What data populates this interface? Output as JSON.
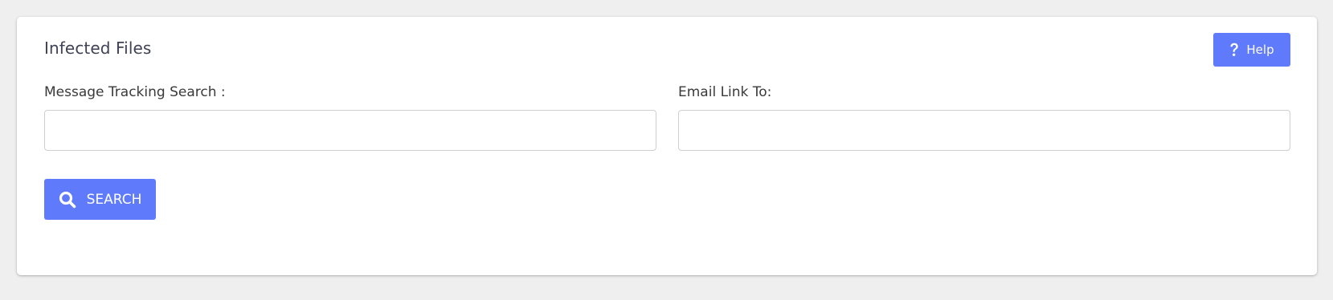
{
  "panel": {
    "title": "Infected Files",
    "help_label": "Help",
    "help_icon": "question-icon"
  },
  "form": {
    "tracking_search": {
      "label": "Message Tracking Search :",
      "value": "",
      "placeholder": ""
    },
    "email_link": {
      "label": "Email Link To:",
      "value": "",
      "placeholder": ""
    },
    "search_button": {
      "label": "SEARCH",
      "icon": "search-icon"
    }
  },
  "colors": {
    "accent": "#5f7bfc",
    "background": "#efefef",
    "card": "#ffffff",
    "title_text": "#3f4254"
  }
}
